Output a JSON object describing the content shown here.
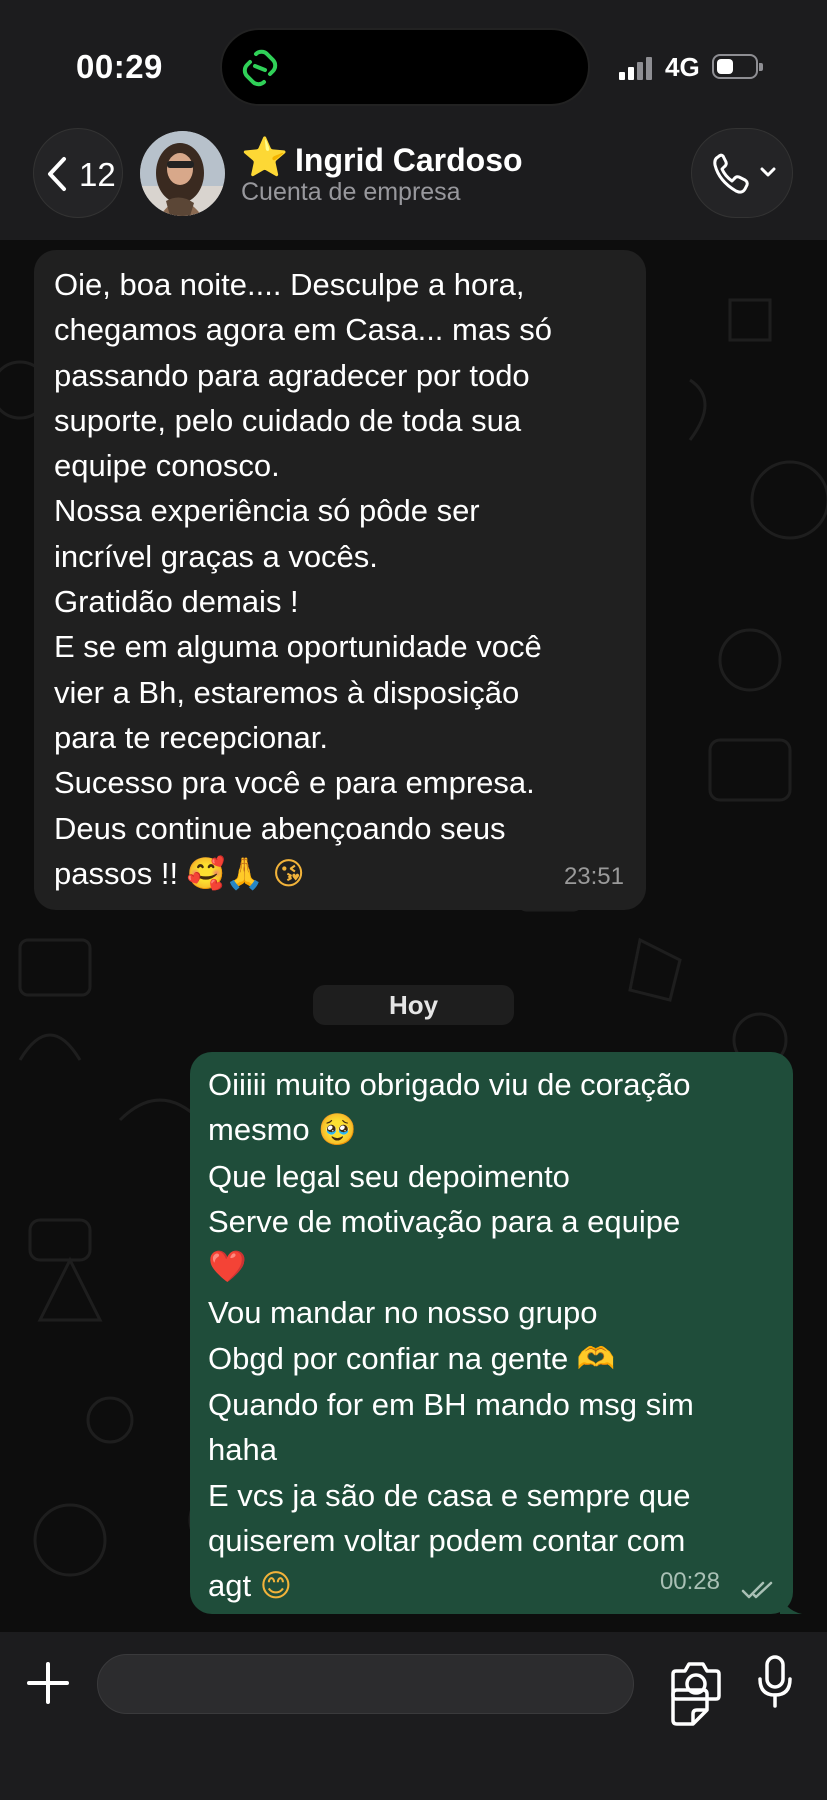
{
  "status": {
    "time": "00:29",
    "network": "4G"
  },
  "header": {
    "back_count": "12",
    "star": "⭐",
    "contact_name": "Ingrid Cardoso",
    "contact_subtitle": "Cuenta de empresa"
  },
  "chat": {
    "incoming": {
      "lines": [
        "Oie, boa noite.... Desculpe a hora,",
        "chegamos agora em Casa...  mas só",
        "passando para agradecer por todo",
        "suporte, pelo cuidado de toda sua",
        "equipe conosco.",
        "Nossa experiência só pôde ser",
        "incrível graças a vocês.",
        "Gratidão demais !",
        "E se em alguma oportunidade você",
        "vier a Bh, estaremos à disposição",
        "para te recepcionar.",
        "Sucesso pra você e para empresa.",
        "Deus continue abençoando seus",
        "passos !!"
      ],
      "emoji_end": [
        "🥰",
        "🙏",
        "😘"
      ],
      "time": "23:51"
    },
    "date_separator": "Hoy",
    "outgoing": {
      "lines": [
        "Oiiiii muito obrigado viu de coração",
        "mesmo",
        "Que legal seu depoimento",
        "Serve de motivação para a equipe",
        "",
        "Vou mandar no nosso grupo",
        "Obgd por confiar na gente",
        "Quando for em BH mando msg sim",
        "haha",
        "E vcs ja são de casa e sempre que",
        "quiserem voltar podem contar com",
        "agt"
      ],
      "emoji_mesmo": "🥹",
      "emoji_heart": "❤️",
      "emoji_hands": "🫶",
      "emoji_smile": "😊",
      "time": "00:28",
      "status": "read"
    }
  },
  "input": {
    "placeholder": ""
  },
  "colors": {
    "outgoing_bubble": "#1f4d3a",
    "incoming_bubble": "#202020",
    "header_bg": "#1c1c1e",
    "green_icon": "#30d158"
  }
}
